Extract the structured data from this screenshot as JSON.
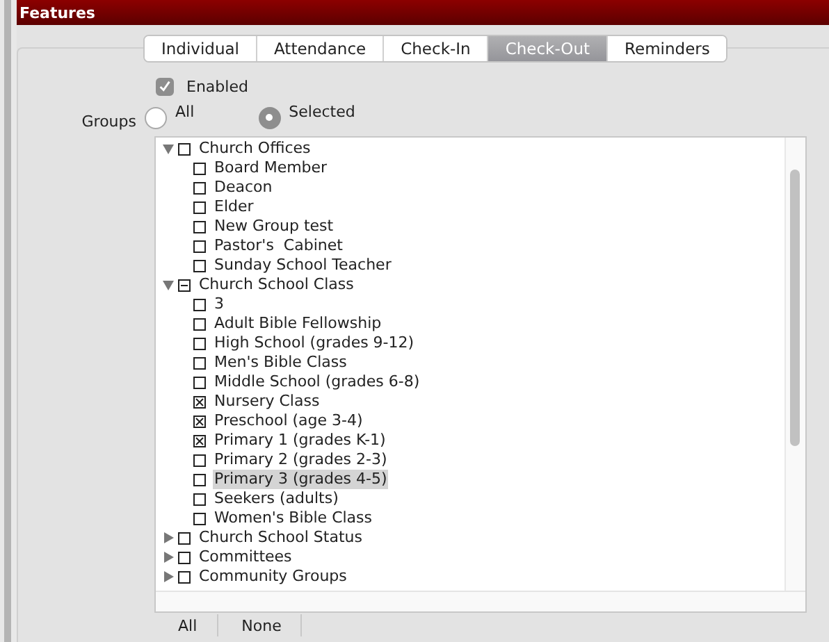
{
  "header": {
    "title": "Features"
  },
  "tabs": [
    {
      "label": "Individual",
      "selected": false
    },
    {
      "label": "Attendance",
      "selected": false
    },
    {
      "label": "Check-In",
      "selected": false
    },
    {
      "label": "Check-Out",
      "selected": true
    },
    {
      "label": "Reminders",
      "selected": false
    }
  ],
  "enabled": {
    "label": "Enabled",
    "checked": true
  },
  "groups": {
    "label": "Groups",
    "options": [
      {
        "label": "All",
        "selected": false
      },
      {
        "label": "Selected",
        "selected": true
      }
    ]
  },
  "tree": [
    {
      "label": "Church Offices",
      "expanded": true,
      "checked": false,
      "partial": false,
      "selected": false,
      "children": [
        {
          "label": "Board Member",
          "checked": false,
          "selected": false
        },
        {
          "label": "Deacon",
          "checked": false,
          "selected": false
        },
        {
          "label": "Elder",
          "checked": false,
          "selected": false
        },
        {
          "label": "New Group test",
          "checked": false,
          "selected": false
        },
        {
          "label": "Pastor's  Cabinet",
          "checked": false,
          "selected": false
        },
        {
          "label": "Sunday School Teacher",
          "checked": false,
          "selected": false
        }
      ]
    },
    {
      "label": "Church School Class",
      "expanded": true,
      "checked": false,
      "partial": true,
      "selected": false,
      "children": [
        {
          "label": "3",
          "checked": false,
          "selected": false
        },
        {
          "label": "Adult Bible Fellowship",
          "checked": false,
          "selected": false
        },
        {
          "label": "High School (grades 9-12)",
          "checked": false,
          "selected": false
        },
        {
          "label": "Men's Bible Class",
          "checked": false,
          "selected": false
        },
        {
          "label": "Middle School (grades 6-8)",
          "checked": false,
          "selected": false
        },
        {
          "label": "Nursery Class",
          "checked": true,
          "selected": false
        },
        {
          "label": "Preschool (age 3-4)",
          "checked": true,
          "selected": false
        },
        {
          "label": "Primary 1 (grades K-1)",
          "checked": true,
          "selected": false
        },
        {
          "label": "Primary 2 (grades 2-3)",
          "checked": false,
          "selected": false
        },
        {
          "label": "Primary 3 (grades 4-5)",
          "checked": false,
          "selected": true
        },
        {
          "label": "Seekers (adults)",
          "checked": false,
          "selected": false
        },
        {
          "label": "Women's Bible Class",
          "checked": false,
          "selected": false
        }
      ]
    },
    {
      "label": "Church School Status",
      "expanded": false,
      "checked": false,
      "partial": false,
      "selected": false
    },
    {
      "label": "Committees",
      "expanded": false,
      "checked": false,
      "partial": false,
      "selected": false
    },
    {
      "label": "Community Groups",
      "expanded": false,
      "checked": false,
      "partial": false,
      "selected": false
    }
  ],
  "buttons": [
    "All",
    "None"
  ]
}
